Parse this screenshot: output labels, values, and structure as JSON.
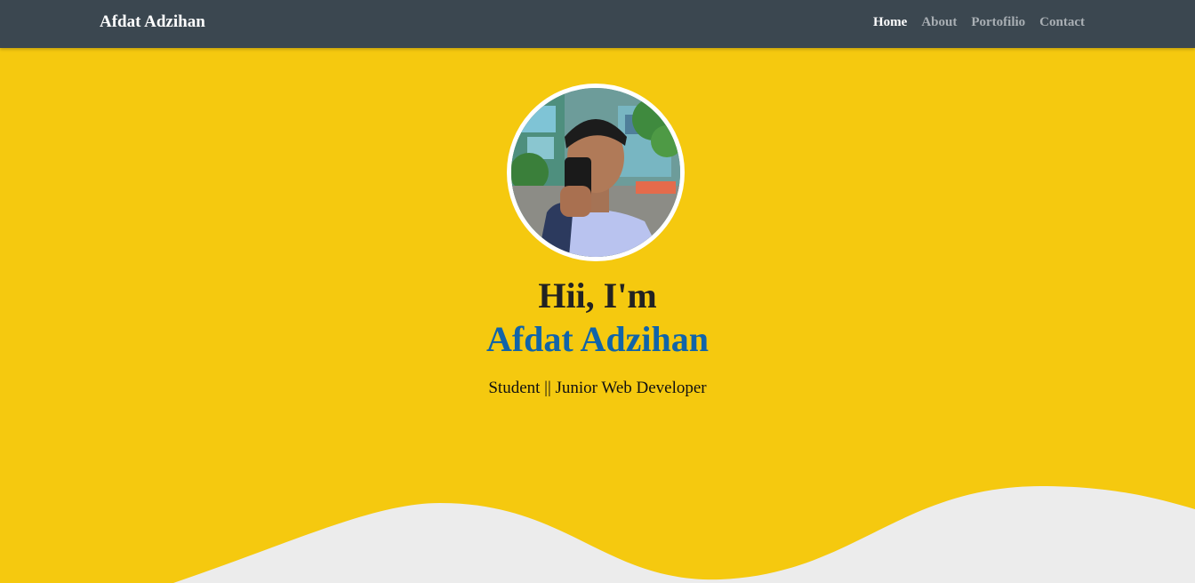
{
  "navbar": {
    "brand": "Afdat Adzihan",
    "links": [
      {
        "label": "Home",
        "active": true
      },
      {
        "label": "About",
        "active": false
      },
      {
        "label": "Portofilio",
        "active": false
      },
      {
        "label": "Contact",
        "active": false
      }
    ]
  },
  "hero": {
    "greeting": "Hii, I'm",
    "name": "Afdat Adzihan",
    "tagline": "Student || Junior Web Developer"
  },
  "colors": {
    "navbar_bg": "#3b4750",
    "hero_bg": "#f5c90f",
    "name_color": "#1164a8",
    "wave_color": "#ececec",
    "nav_active": "#ffffff",
    "nav_inactive": "#a9afb4"
  }
}
